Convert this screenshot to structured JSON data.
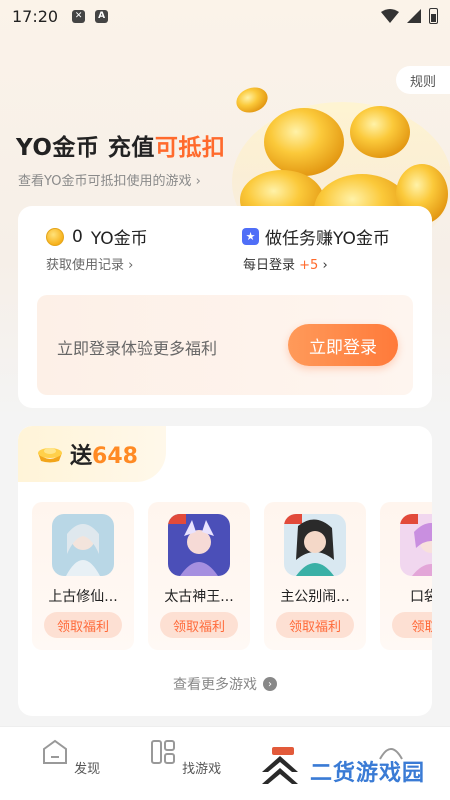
{
  "status_bar": {
    "time": "17:20",
    "icon1": "x-badge-icon",
    "icon2": "a-badge-icon"
  },
  "rules": {
    "label": "规则"
  },
  "hero": {
    "title_main": "YO金币 充值",
    "title_highlight": "可抵扣",
    "subtitle": "查看YO金币可抵扣使用的游戏",
    "colors": {
      "highlight": "#ff6a2c"
    }
  },
  "wallet": {
    "balance": "0",
    "balance_unit": "YO金币",
    "history_link": "获取使用记录",
    "task_title": "做任务赚YO金币",
    "daily_login": "每日登录",
    "daily_bonus": "+5"
  },
  "login": {
    "prompt": "立即登录体验更多福利",
    "button": "立即登录",
    "colors": {
      "button": "#ff7a3a"
    }
  },
  "gift": {
    "title_prefix": "送",
    "amount": "648",
    "games": [
      {
        "name": "上古修仙...",
        "claim": "领取福利"
      },
      {
        "name": "太古神王...",
        "claim": "领取福利"
      },
      {
        "name": "主公别闹...",
        "claim": "领取福利"
      },
      {
        "name": "口袋山",
        "claim": "领取福"
      }
    ],
    "more": "查看更多游戏"
  },
  "nav": {
    "discover": "发现",
    "find_games": "找游戏"
  },
  "watermark": {
    "text": "二货游戏园"
  }
}
